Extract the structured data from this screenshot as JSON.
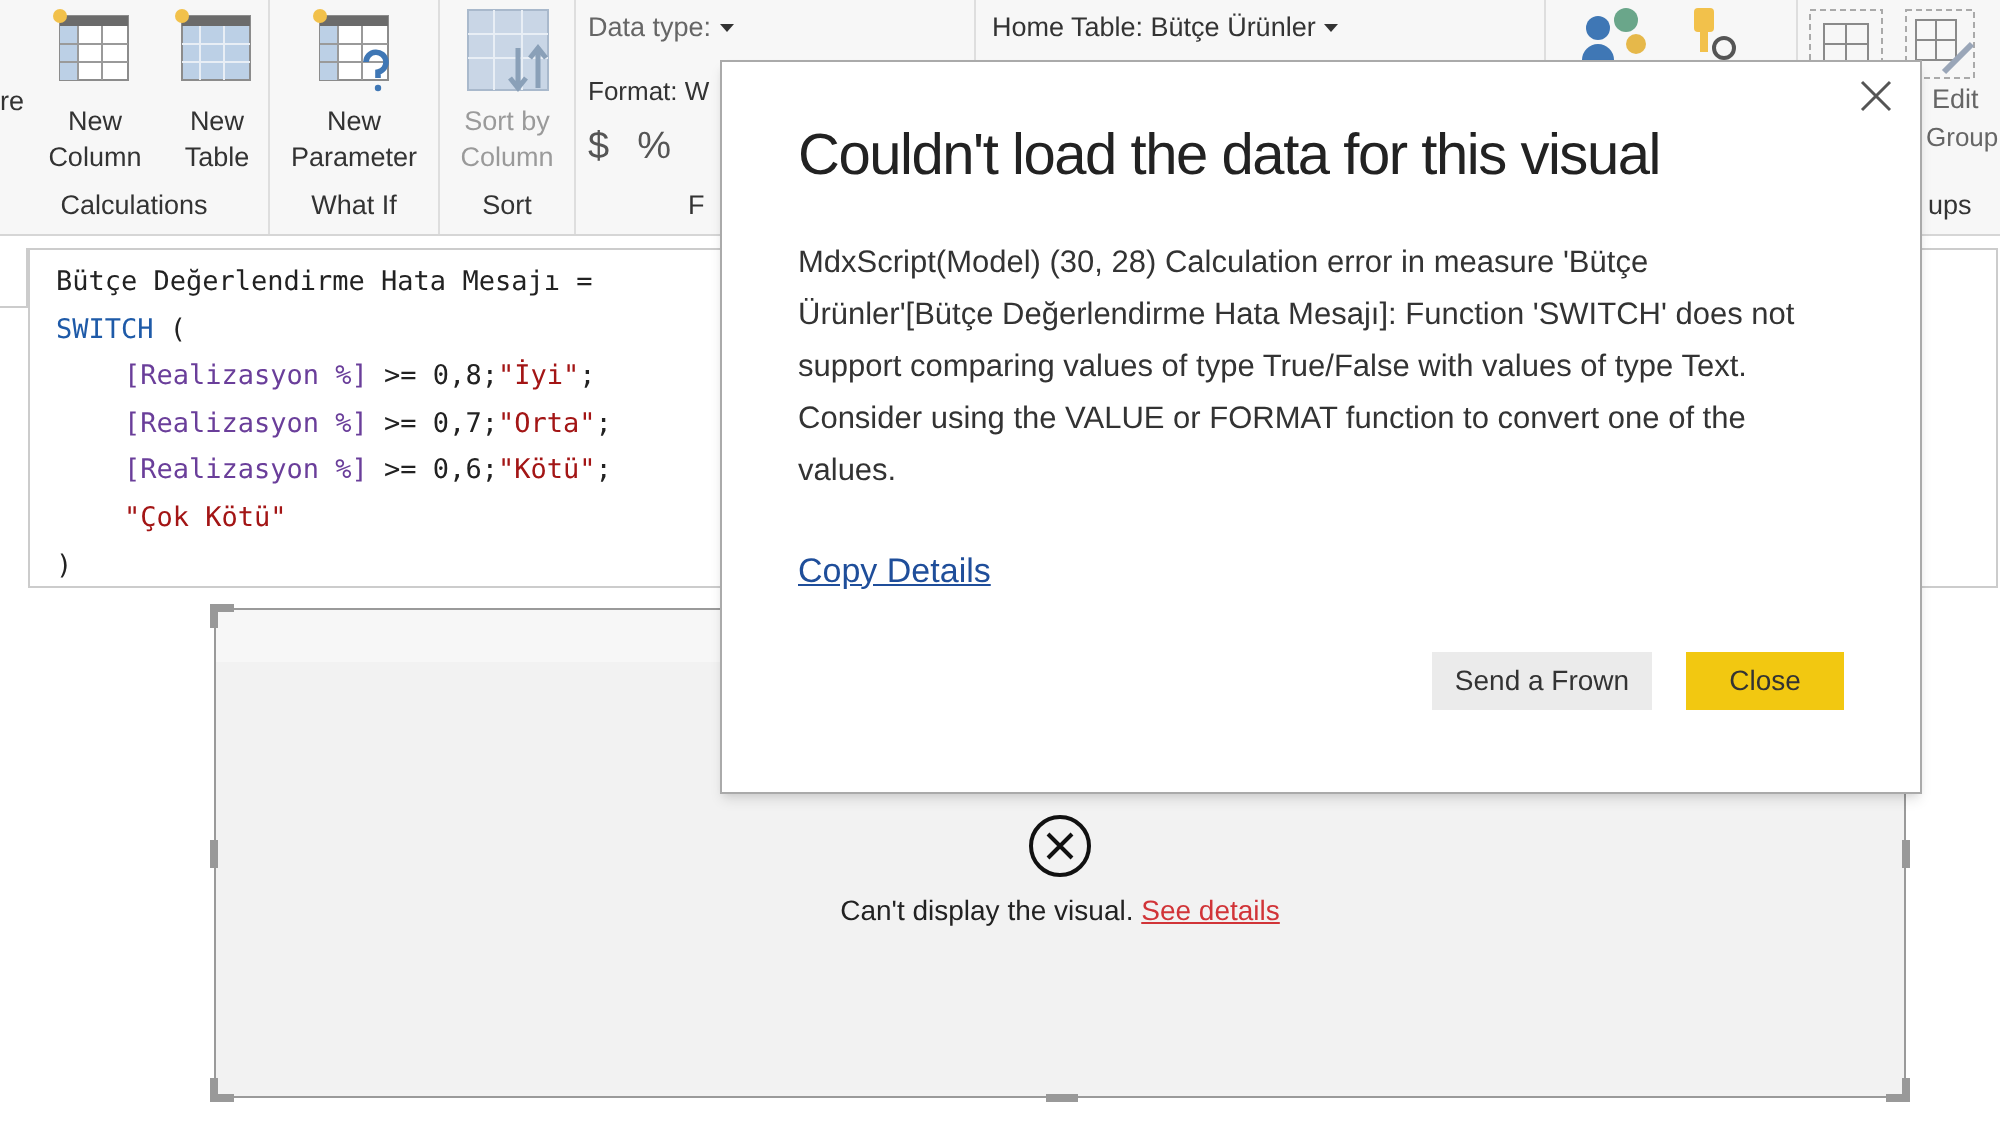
{
  "ribbon": {
    "partial_label": "re",
    "groups": [
      {
        "label": "Calculations",
        "buttons": [
          {
            "label": "New Column",
            "disabled": false
          },
          {
            "label": "New Table",
            "disabled": false
          }
        ]
      },
      {
        "label": "What If",
        "buttons": [
          {
            "label": "New Parameter",
            "disabled": false
          }
        ]
      },
      {
        "label": "Sort",
        "buttons": [
          {
            "label": "Sort by Column",
            "disabled": true
          }
        ]
      }
    ],
    "data_type": "Data type:",
    "format": "Format: W",
    "currency": "$",
    "percent": "%",
    "formatting_group": "F",
    "home_table": "Home Table: Bütçe Ürünler",
    "edit_groups": "Edit",
    "groups_cut": "Group",
    "groups_label": "ups"
  },
  "formula": {
    "lines": [
      {
        "tokens": [
          {
            "kind": "plain",
            "text": "Bütçe Değerlendirme Hata Mesajı ="
          }
        ]
      },
      {
        "tokens": [
          {
            "kind": "keyword",
            "text": "SWITCH"
          },
          {
            "kind": "plain",
            "text": " ("
          }
        ],
        "children": [
          {
            "tokens": [
              {
                "kind": "measure",
                "text": "[Realizasyon %]"
              },
              {
                "kind": "plain",
                "text": " >= 0,8;"
              },
              {
                "kind": "string",
                "text": "\"İyi\""
              },
              {
                "kind": "plain",
                "text": ";"
              }
            ]
          },
          {
            "tokens": [
              {
                "kind": "measure",
                "text": "[Realizasyon %]"
              },
              {
                "kind": "plain",
                "text": " >= 0,7;"
              },
              {
                "kind": "string",
                "text": "\"Orta\""
              },
              {
                "kind": "plain",
                "text": ";"
              }
            ]
          },
          {
            "tokens": [
              {
                "kind": "measure",
                "text": "[Realizasyon %]"
              },
              {
                "kind": "plain",
                "text": " >= 0,6;"
              },
              {
                "kind": "string",
                "text": "\"Kötü\""
              },
              {
                "kind": "plain",
                "text": ";"
              }
            ]
          },
          {
            "tokens": [
              {
                "kind": "string",
                "text": "\"Çok Kötü\""
              }
            ]
          }
        ]
      },
      {
        "tokens": [
          {
            "kind": "plain",
            "text": ")"
          }
        ]
      }
    ]
  },
  "visual": {
    "message": "Can't display the visual.",
    "link": "See details"
  },
  "dialog": {
    "title": "Couldn't load the data for this visual",
    "body": "MdxScript(Model) (30, 28) Calculation error in measure 'Bütçe Ürünler'[Bütçe Değerlendirme Hata Mesajı]: Function 'SWITCH' does not support comparing values of type True/False with values of type Text. Consider using the VALUE or FORMAT function to convert one of the values.",
    "link": "Copy Details",
    "buttons": [
      {
        "label": "Send a Frown",
        "kind": "secondary"
      },
      {
        "label": "Close",
        "kind": "primary"
      }
    ]
  }
}
